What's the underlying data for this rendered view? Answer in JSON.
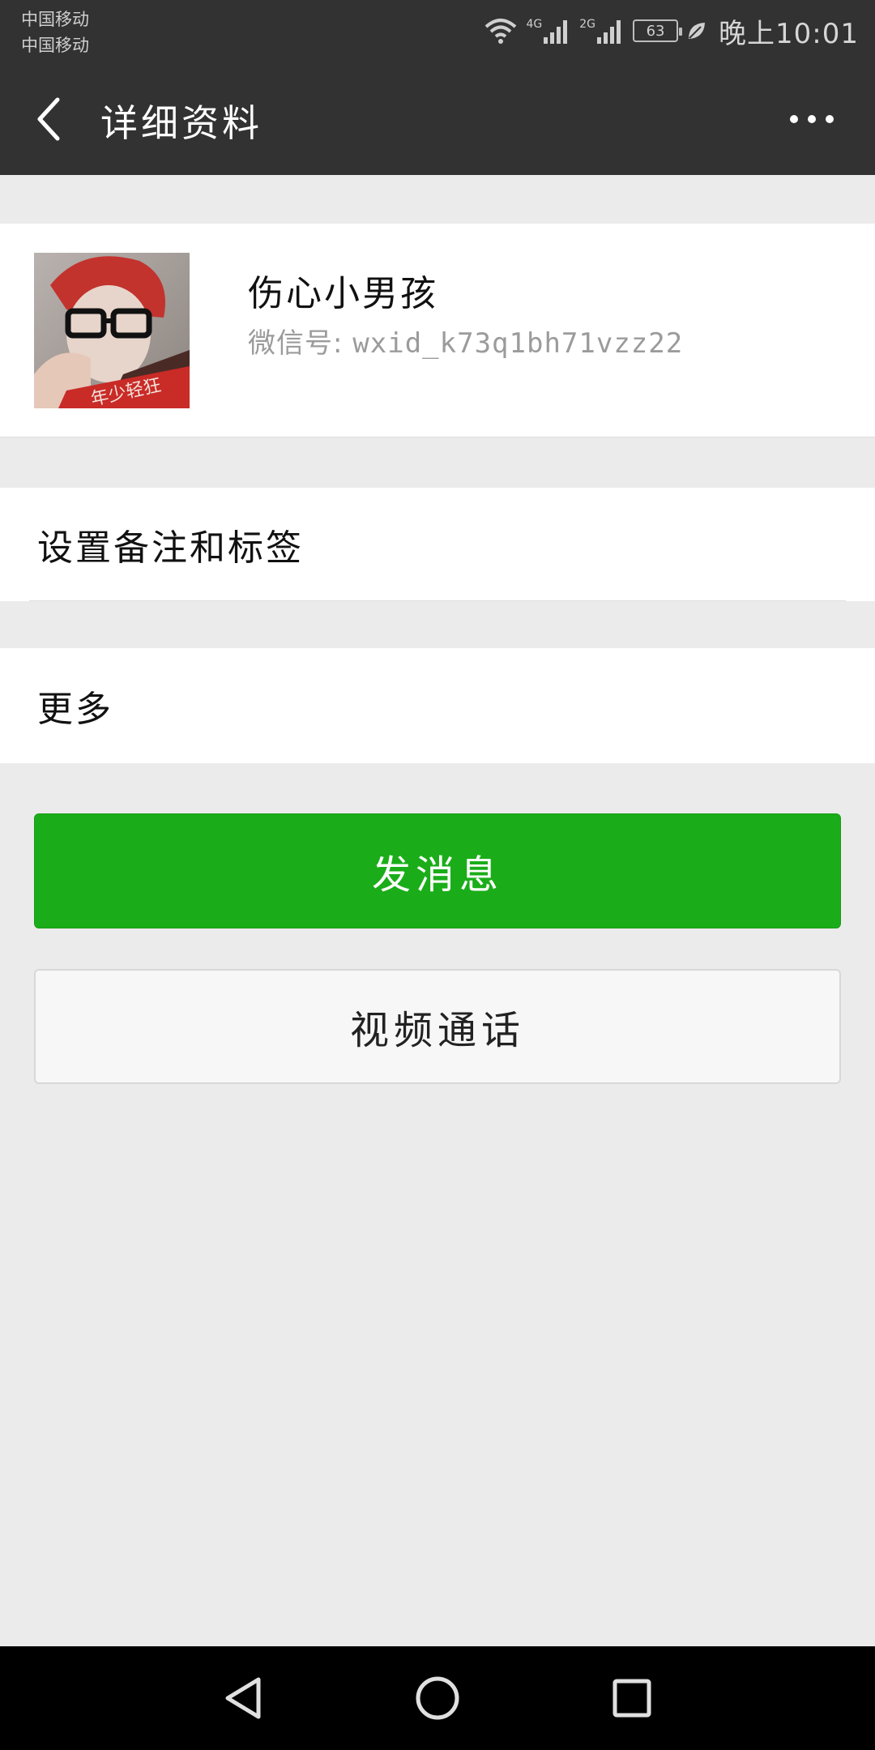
{
  "status_bar": {
    "carrier_1": "中国移动",
    "carrier_2": "中国移动",
    "network_1": "4G",
    "network_2": "2G",
    "battery": "63",
    "time": "晚上10:01"
  },
  "title_bar": {
    "title": "详细资料"
  },
  "profile": {
    "nickname": "伤心小男孩",
    "wechat_id_label": "微信号:",
    "wechat_id": "wxid_k73q1bh71vzz22",
    "avatar_text": "年少轻狂"
  },
  "menu": {
    "remark_label": "设置备注和标签",
    "more_label": "更多"
  },
  "actions": {
    "send_message": "发消息",
    "video_call": "视频通话"
  },
  "colors": {
    "header_bg": "#323232",
    "primary_green": "#1aad19",
    "page_bg": "#ebebeb"
  }
}
